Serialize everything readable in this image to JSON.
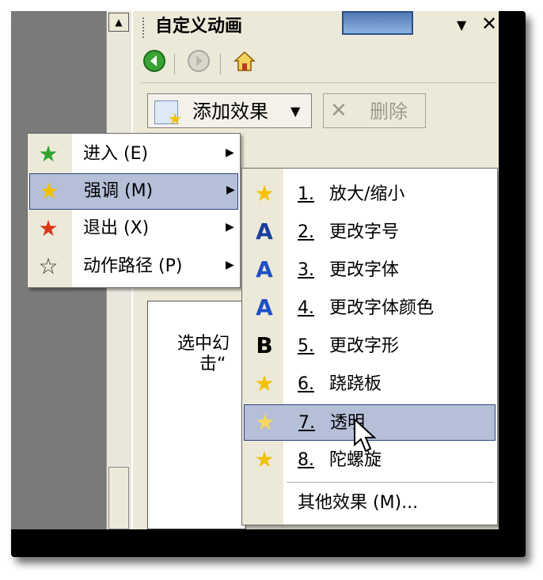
{
  "panel": {
    "title": "自定义动画",
    "dropdown_arrow": "▼",
    "close": "✕"
  },
  "toolbar": {
    "add_effect_label": "添加效果",
    "delete_label": "删除"
  },
  "slide_hint": {
    "line1": "选中幻",
    "line2": "击“"
  },
  "menu": {
    "items": [
      {
        "icon": "green-star-icon",
        "label": "进入 (E)"
      },
      {
        "icon": "yellow-star-icon",
        "label": "强调 (M)"
      },
      {
        "icon": "red-star-icon",
        "label": "退出 (X)"
      },
      {
        "icon": "outline-star-icon",
        "label": "动作路径 (P)"
      }
    ]
  },
  "submenu": {
    "items": [
      {
        "num": "1.",
        "label": "放大/缩小",
        "icon": "grow-star-icon"
      },
      {
        "num": "2.",
        "label": "更改字号",
        "icon": "font-size-icon"
      },
      {
        "num": "3.",
        "label": "更改字体",
        "icon": "font-icon"
      },
      {
        "num": "4.",
        "label": "更改字体颜色",
        "icon": "font-color-icon"
      },
      {
        "num": "5.",
        "label": "更改字形",
        "icon": "bold-icon"
      },
      {
        "num": "6.",
        "label": "跷跷板",
        "icon": "teeter-star-icon"
      },
      {
        "num": "7.",
        "label": "透明",
        "icon": "transparent-star-icon"
      },
      {
        "num": "8.",
        "label": "陀螺旋",
        "icon": "spin-star-icon"
      }
    ],
    "more_label": "其他效果 (M)..."
  },
  "colors": {
    "highlight": "#b5bfd8",
    "highlight_border": "#2c4380",
    "panel_bg": "#ece9d8"
  }
}
